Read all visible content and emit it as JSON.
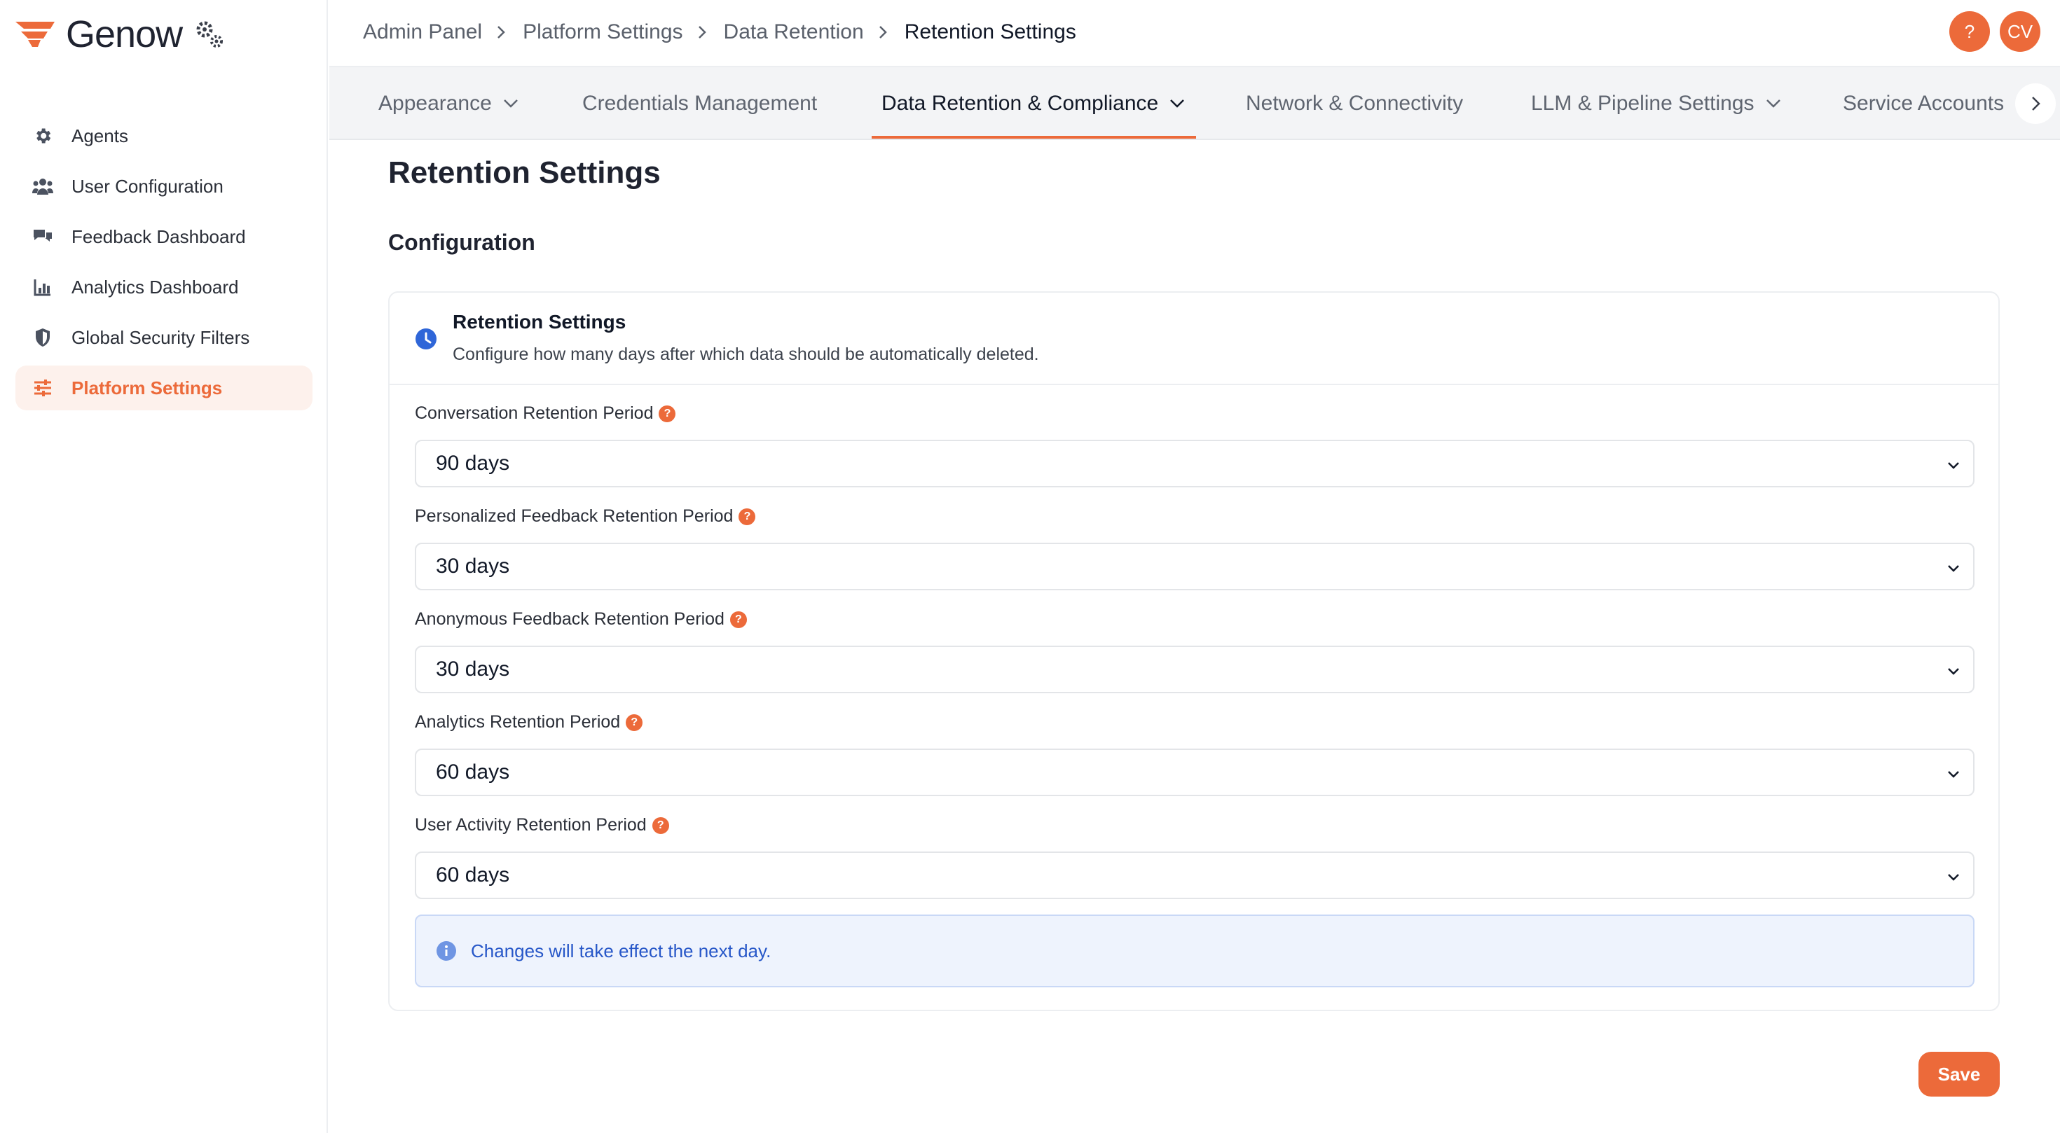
{
  "brand": {
    "name": "Genow",
    "accent_color": "#ec6a3a",
    "logo_icon": "genow-logo-icon",
    "gears_icon": "gears-icon"
  },
  "sidebar": {
    "items": [
      {
        "label": "Agents",
        "icon": "gear-icon",
        "active": false
      },
      {
        "label": "User Configuration",
        "icon": "users-icon",
        "active": false
      },
      {
        "label": "Feedback Dashboard",
        "icon": "chat-bubbles-icon",
        "active": false
      },
      {
        "label": "Analytics Dashboard",
        "icon": "bar-chart-icon",
        "active": false
      },
      {
        "label": "Global Security Filters",
        "icon": "shield-icon",
        "active": false
      },
      {
        "label": "Platform Settings",
        "icon": "sliders-icon",
        "active": true
      }
    ]
  },
  "breadcrumb": [
    "Admin Panel",
    "Platform Settings",
    "Data Retention",
    "Retention Settings"
  ],
  "header": {
    "help_label": "?",
    "avatar_initials": "CV"
  },
  "tabs": [
    {
      "label": "Appearance",
      "has_dropdown": true,
      "active": false
    },
    {
      "label": "Credentials Management",
      "has_dropdown": false,
      "active": false
    },
    {
      "label": "Data Retention & Compliance",
      "has_dropdown": true,
      "active": true
    },
    {
      "label": "Network & Connectivity",
      "has_dropdown": false,
      "active": false
    },
    {
      "label": "LLM & Pipeline Settings",
      "has_dropdown": true,
      "active": false
    },
    {
      "label": "Service Accounts",
      "has_dropdown": false,
      "active": false
    }
  ],
  "main": {
    "page_title": "Retention Settings",
    "section_title": "Configuration"
  },
  "card": {
    "title": "Retention Settings",
    "subtitle": "Configure how many days after which data should be automatically deleted.",
    "fields": [
      {
        "label": "Conversation Retention Period",
        "value": "90 days"
      },
      {
        "label": "Personalized Feedback Retention Period",
        "value": "30 days"
      },
      {
        "label": "Anonymous Feedback Retention Period",
        "value": "30 days"
      },
      {
        "label": "Analytics Retention Period",
        "value": "60 days"
      },
      {
        "label": "User Activity Retention Period",
        "value": "60 days"
      }
    ],
    "info_text": "Changes will take effect the next day."
  },
  "actions": {
    "save_label": "Save"
  }
}
